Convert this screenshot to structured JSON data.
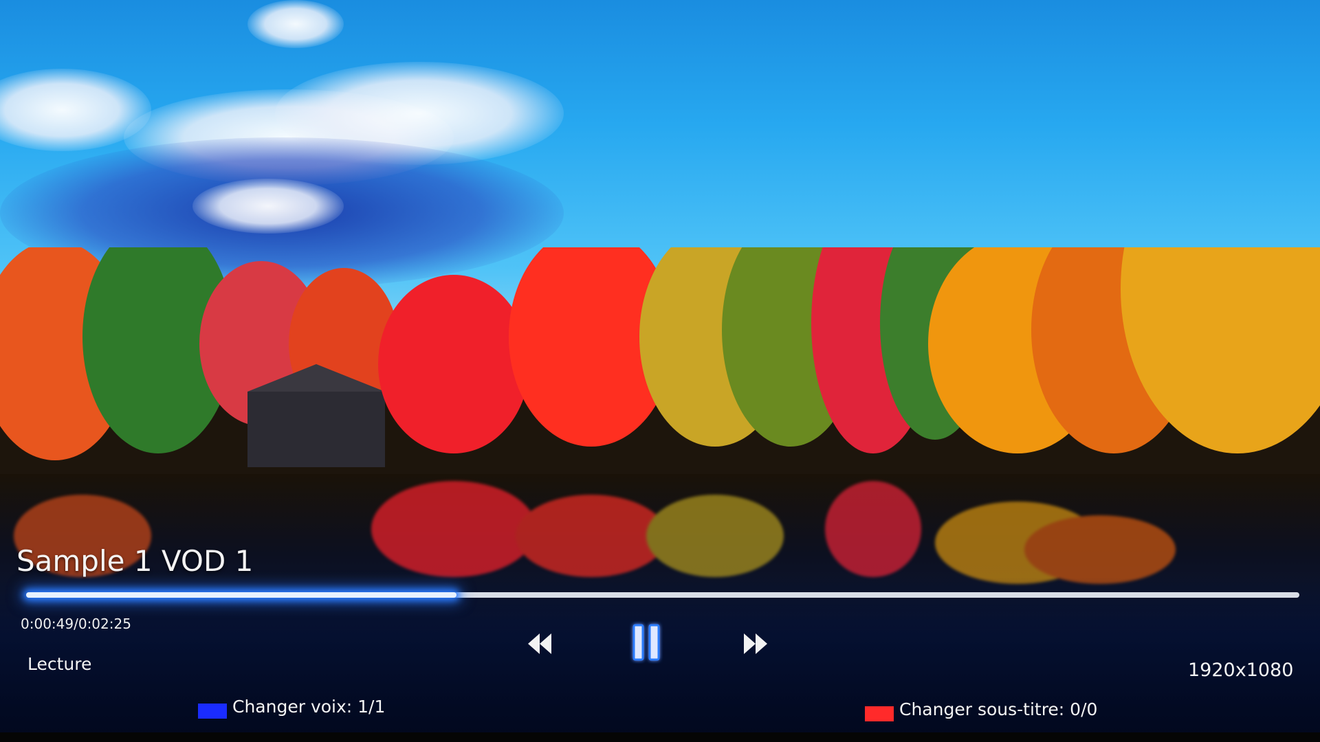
{
  "player": {
    "title": "Sample 1 VOD 1",
    "time_display": "0:00:49/0:02:25",
    "progress": 0.338,
    "state_label": "Lecture",
    "resolution": "1920x1080"
  },
  "controls": {
    "rewind_icon": "rewind-icon",
    "pause_icon": "pause-icon",
    "forward_icon": "fast-forward-icon"
  },
  "color_keys": {
    "voice": {
      "label": "Changer voix: 1/1",
      "color": "#1a2cff"
    },
    "subtitle": {
      "label": "Changer sous-titre: 0/0",
      "color": "#ff2a2a"
    }
  },
  "colors": {
    "accent": "#2b7bff",
    "text": "#f4f4f4"
  }
}
